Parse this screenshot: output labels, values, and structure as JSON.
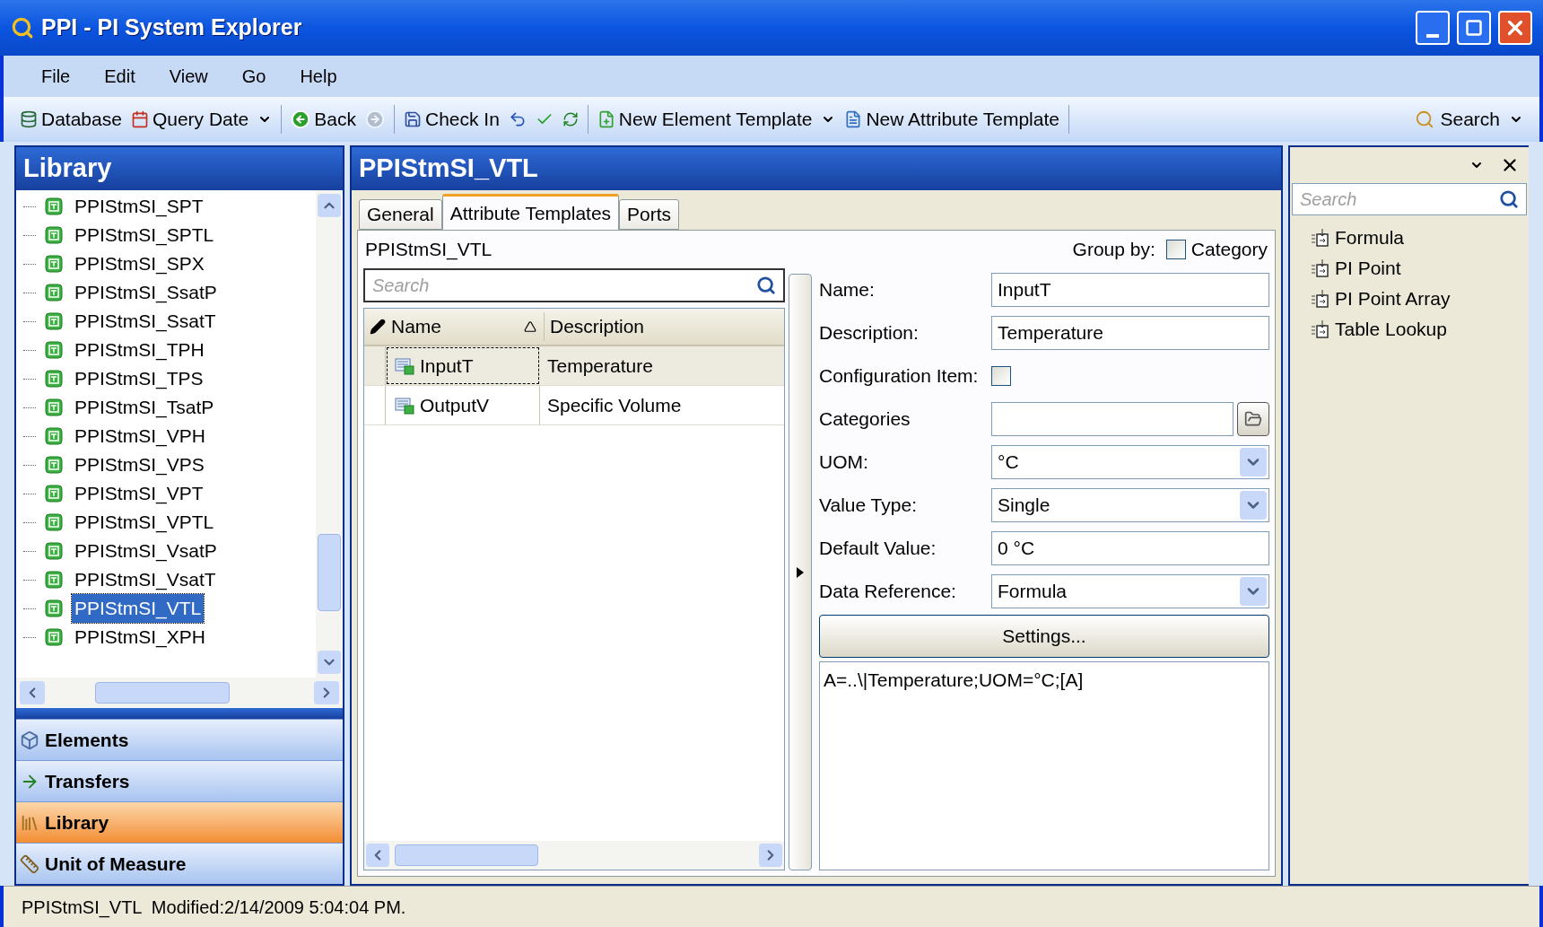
{
  "window": {
    "title": "PPI - PI System Explorer"
  },
  "menu": [
    "File",
    "Edit",
    "View",
    "Go",
    "Help"
  ],
  "toolbar": [
    {
      "kind": "button",
      "label": "Database",
      "disabled": false
    },
    {
      "kind": "button",
      "label": "Query Date",
      "dropdown": true,
      "disabled": false
    },
    {
      "kind": "separator"
    },
    {
      "kind": "button",
      "label": "Back",
      "disabled": false
    },
    {
      "kind": "icon",
      "disabled": true
    },
    {
      "kind": "separator"
    },
    {
      "kind": "button",
      "label": "Check In",
      "disabled": false
    },
    {
      "kind": "icon",
      "disabled": false
    },
    {
      "kind": "icon",
      "disabled": false
    },
    {
      "kind": "icon",
      "disabled": false
    },
    {
      "kind": "separator"
    },
    {
      "kind": "button",
      "label": "New Element Template",
      "dropdown": true,
      "disabled": false
    },
    {
      "kind": "button",
      "label": "New Attribute Template",
      "disabled": false
    },
    {
      "kind": "separator"
    }
  ],
  "toolbar_search": {
    "label": "Search",
    "dropdown": true
  },
  "library": {
    "title": "Library",
    "items": [
      {
        "label": "PPIStmSI_SPT",
        "selected": false
      },
      {
        "label": "PPIStmSI_SPTL",
        "selected": false
      },
      {
        "label": "PPIStmSI_SPX",
        "selected": false
      },
      {
        "label": "PPIStmSI_SsatP",
        "selected": false
      },
      {
        "label": "PPIStmSI_SsatT",
        "selected": false
      },
      {
        "label": "PPIStmSI_TPH",
        "selected": false
      },
      {
        "label": "PPIStmSI_TPS",
        "selected": false
      },
      {
        "label": "PPIStmSI_TsatP",
        "selected": false
      },
      {
        "label": "PPIStmSI_VPH",
        "selected": false
      },
      {
        "label": "PPIStmSI_VPS",
        "selected": false
      },
      {
        "label": "PPIStmSI_VPT",
        "selected": false
      },
      {
        "label": "PPIStmSI_VPTL",
        "selected": false
      },
      {
        "label": "PPIStmSI_VsatP",
        "selected": false
      },
      {
        "label": "PPIStmSI_VsatT",
        "selected": false
      },
      {
        "label": "PPIStmSI_VTL",
        "selected": true
      },
      {
        "label": "PPIStmSI_XPH",
        "selected": false
      }
    ]
  },
  "nav": [
    {
      "label": "Elements",
      "selected": false
    },
    {
      "label": "Transfers",
      "selected": false
    },
    {
      "label": "Library",
      "selected": true
    },
    {
      "label": "Unit of Measure",
      "selected": false
    }
  ],
  "detail": {
    "title": "PPIStmSI_VTL",
    "tabs": [
      {
        "label": "General",
        "selected": false
      },
      {
        "label": "Attribute Templates",
        "selected": true
      },
      {
        "label": "Ports",
        "selected": false
      }
    ],
    "template_name": "PPIStmSI_VTL",
    "group_by": {
      "label": "Group by:",
      "option": "Category",
      "checked": false
    },
    "search": {
      "placeholder": "Search"
    },
    "columns": [
      "Name",
      "Description"
    ],
    "rows": [
      {
        "name": "InputT",
        "description": "Temperature",
        "selected": true
      },
      {
        "name": "OutputV",
        "description": "Specific Volume",
        "selected": false
      }
    ],
    "fields": [
      {
        "kind": "text",
        "label": "Name:",
        "value": "InputT"
      },
      {
        "kind": "text",
        "label": "Description:",
        "value": "Temperature"
      },
      {
        "kind": "checkbox",
        "label": "Configuration Item:",
        "checked": false
      },
      {
        "kind": "picker",
        "label": "Categories"
      },
      {
        "kind": "dropdown",
        "label": "UOM:",
        "value": "°C"
      },
      {
        "kind": "dropdown",
        "label": "Value Type:",
        "value": "Single"
      },
      {
        "kind": "text",
        "label": "Default Value:",
        "value": "0 °C"
      },
      {
        "kind": "dropdown",
        "label": "Data Reference:",
        "value": "Formula"
      }
    ],
    "settings_button": "Settings...",
    "config_string": "A=..\\|Temperature;UOM=°C;[A]"
  },
  "right_pane": {
    "search": {
      "placeholder": "Search"
    },
    "items": [
      "Formula",
      "PI Point",
      "PI Point Array",
      "Table Lookup"
    ]
  },
  "status_bar": "PPIStmSI_VTL  Modified:2/14/2009 5:04:04 PM."
}
